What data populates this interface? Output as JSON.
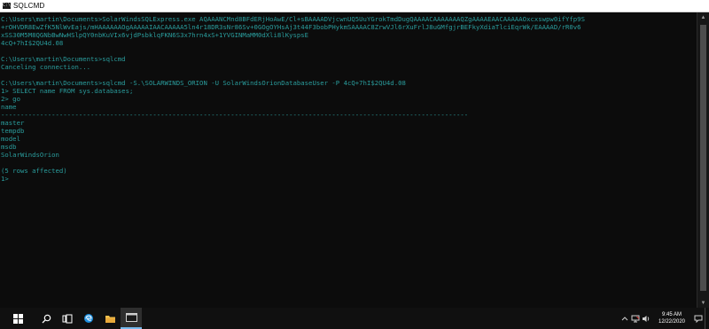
{
  "window": {
    "icon_label": "C:\\",
    "title": "SQLCMD"
  },
  "console": {
    "lines": [
      "C:\\Users\\martin\\Documents>SolarWindsSQLExpress.exe AQAAANCMnd8BFdERjHoAwE/Cl+sBAAAADVjcwnUQ5UuYGrokTmdDugQAAAACAAAAAAAQZgAAAAEAACAAAAAOxcxswpw0ifYfp9S",
      "+rOHVDR8EwZfK5NlWvEajs/mHAAAAAAOgAAAAAIAACAAAAA5ln4r18DR3sNr86Sv+0GOgOYHsAj3t44F3bobPHykmSAAAAC8ZrwVJl6rXuFrlJ8uGMfgjrBEFkyXdiaTlciEqrWk/EAAAAD/rR0v6",
      "xSS30M5M8QGNbBwNwHSlpQY0nbKuVIx6vjdPsbklqFKN6S3x7hrn4xS+1YVGINMaMM0dXli8lKyspsE",
      "4cQ+7hI$2QU4d.08",
      "",
      "C:\\Users\\martin\\Documents>sqlcmd",
      "Canceling connection...",
      "",
      "C:\\Users\\martin\\Documents>sqlcmd -S.\\SOLARWINDS_ORION -U SolarWindsOrionDatabaseUser -P 4cQ+7hI$2QU4d.08",
      "1> SELECT name FROM sys.databases;",
      "2> go",
      "name",
      "------------------------------------------------------------------------------------------------------------------------",
      "master",
      "tempdb",
      "model",
      "msdb",
      "SolarWindsOrion",
      "",
      "(5 rows affected)",
      "1>"
    ]
  },
  "taskbar": {
    "items": [
      {
        "name": "start-button",
        "icon": "windows-logo-icon"
      },
      {
        "name": "search-button",
        "icon": "search-icon"
      },
      {
        "name": "task-view-button",
        "icon": "task-view-icon"
      },
      {
        "name": "edge-button",
        "icon": "edge-icon"
      },
      {
        "name": "file-explorer-button",
        "icon": "folder-icon"
      },
      {
        "name": "sqlcmd-taskbar-button",
        "icon": "console-icon"
      }
    ],
    "tray": {
      "time": "9:45 AM",
      "date": "12/22/2020"
    }
  },
  "colors": {
    "console_text": "#2a9d9d",
    "console_bg": "#0c0c0c",
    "taskbar_bg": "#101010",
    "accent": "#76b9ed"
  }
}
